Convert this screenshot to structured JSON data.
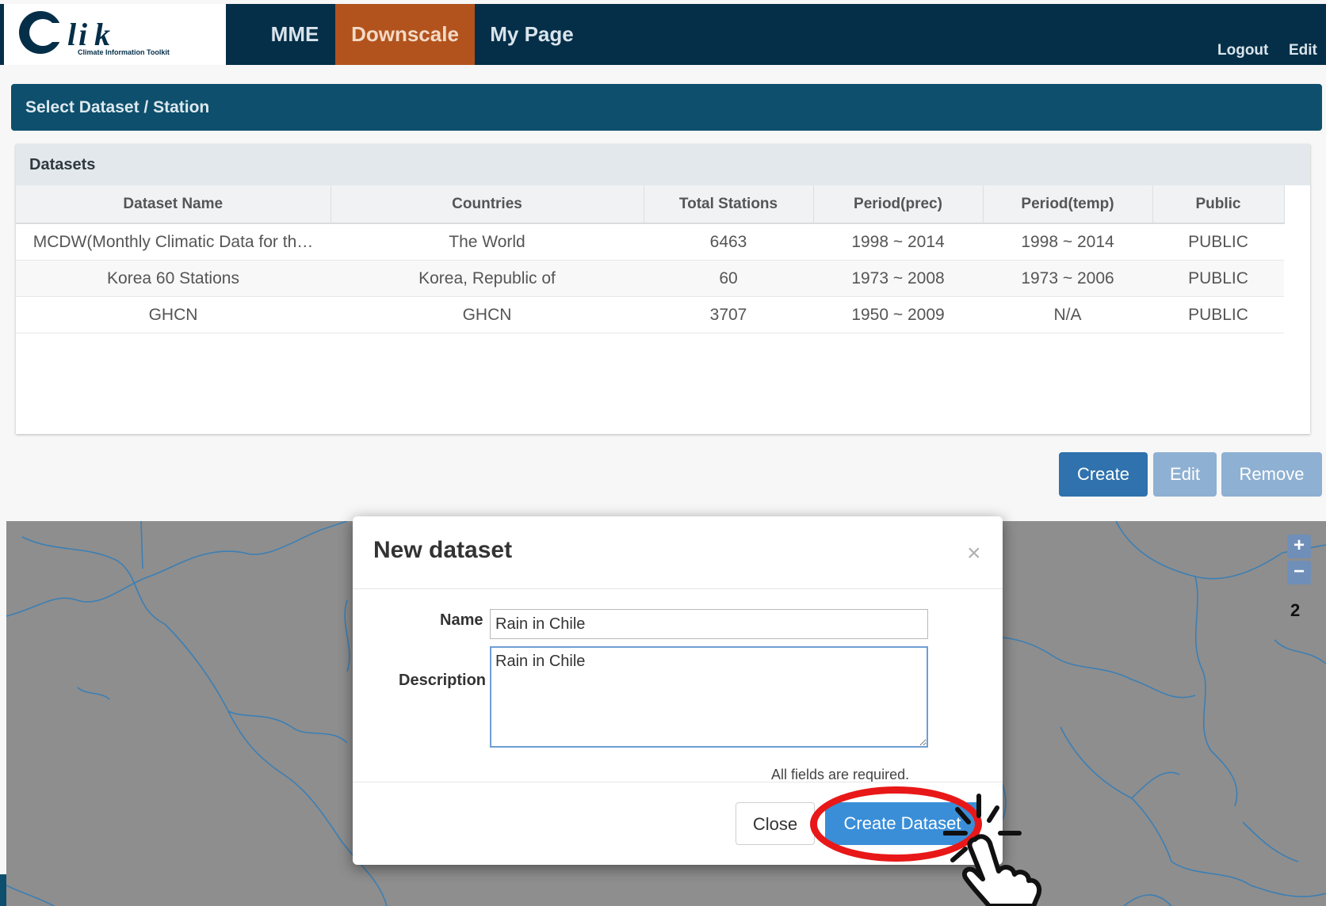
{
  "app": {
    "logo_letters": "Clik",
    "logo_subtitle": "Climate Information Toolkit"
  },
  "nav": {
    "items": [
      {
        "label": "MME",
        "active": false
      },
      {
        "label": "Downscale",
        "active": true
      },
      {
        "label": "My Page",
        "active": false
      }
    ],
    "logout": "Logout",
    "edit": "Edit"
  },
  "panel": {
    "title": "Select Dataset / Station"
  },
  "datasets": {
    "caption": "Datasets",
    "columns": [
      "Dataset Name",
      "Countries",
      "Total Stations",
      "Period(prec)",
      "Period(temp)",
      "Public"
    ],
    "rows": [
      [
        "MCDW(Monthly Climatic Data for th…",
        "The World",
        "6463",
        "1998 ~ 2014",
        "1998 ~ 2014",
        "PUBLIC"
      ],
      [
        "Korea 60 Stations",
        "Korea, Republic of",
        "60",
        "1973 ~ 2008",
        "1973 ~ 2006",
        "PUBLIC"
      ],
      [
        "GHCN",
        "GHCN",
        "3707",
        "1950 ~ 2009",
        "N/A",
        "PUBLIC"
      ]
    ]
  },
  "actions": {
    "create": "Create",
    "edit": "Edit",
    "remove": "Remove"
  },
  "map": {
    "zoom_in": "+",
    "zoom_out": "−",
    "zoom_level": "2"
  },
  "modal": {
    "title": "New dataset",
    "close_x": "×",
    "name_label": "Name",
    "name_value": "Rain in Chile",
    "description_label": "Description",
    "description_value": "Rain in Chile",
    "required_note": "All fields are required.",
    "close_button": "Close",
    "create_button": "Create Dataset"
  },
  "colors": {
    "nav_bg": "#052f48",
    "active_tab": "#b2531d",
    "panel_header": "#0d4f6c",
    "primary_button": "#2f72ad",
    "highlight_ring": "#e81818"
  }
}
